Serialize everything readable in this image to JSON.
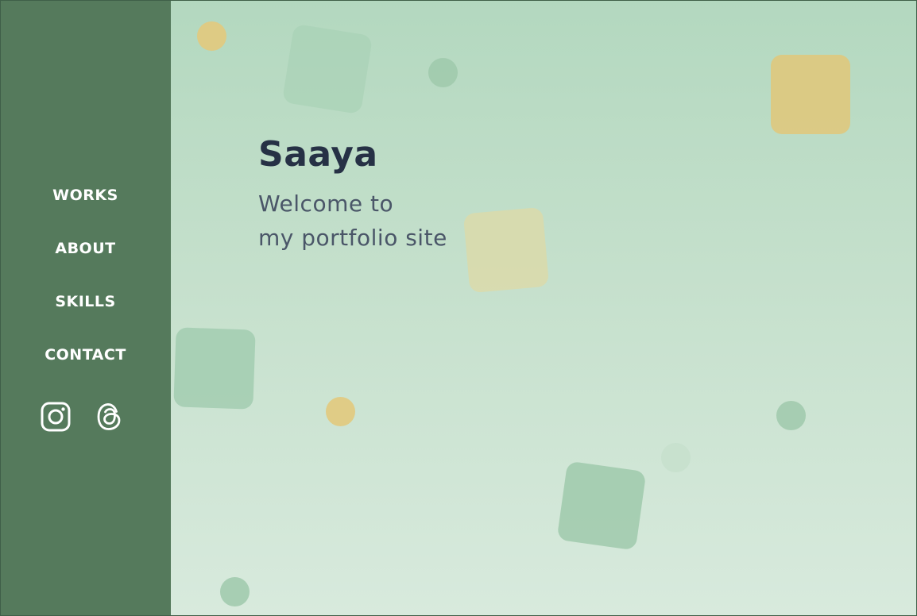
{
  "sidebar": {
    "nav": [
      {
        "label": "WORKS"
      },
      {
        "label": "ABOUT"
      },
      {
        "label": "SKILLS"
      },
      {
        "label": "CONTACT"
      }
    ],
    "social": [
      {
        "icon": "instagram-icon"
      },
      {
        "icon": "threads-icon"
      }
    ]
  },
  "hero": {
    "name": "Saaya",
    "greeting_line1": "Welcome to",
    "greeting_line2": "my portfolio site"
  },
  "colors": {
    "sidebar": "#557a5c",
    "background_top": "#b3d8bf",
    "background_bottom": "#d8eadd",
    "heading": "#263145",
    "subtext": "#4a5668",
    "accent_yellow": "#e2c97d",
    "accent_green": "#9fc9ac"
  }
}
